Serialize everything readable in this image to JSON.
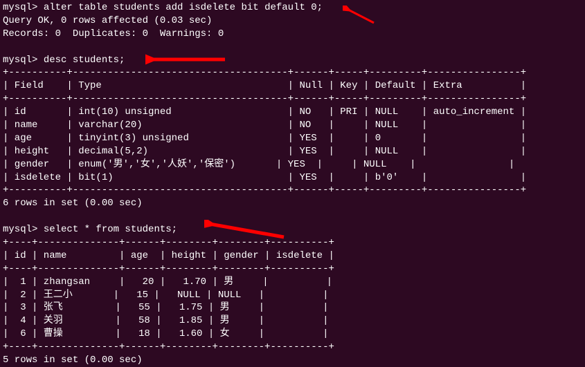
{
  "session": {
    "prompt1": "mysql> ",
    "cmd1": "alter table students add isdelete bit default 0;",
    "result1a": "Query OK, 0 rows affected (0.03 sec)",
    "result1b": "Records: 0  Duplicates: 0  Warnings: 0",
    "prompt2": "mysql> ",
    "cmd2": "desc students;",
    "desc_border": "+----------+-------------------------------------+------+-----+---------+----------------+",
    "desc_header": "| Field    | Type                                | Null | Key | Default | Extra          |",
    "desc_rows": [
      "| id       | int(10) unsigned                    | NO   | PRI | NULL    | auto_increment |",
      "| name     | varchar(20)                         | NO   |     | NULL    |                |",
      "| age      | tinyint(3) unsigned                 | YES  |     | 0       |                |",
      "| height   | decimal(5,2)                        | YES  |     | NULL    |                |",
      "| gender   | enum('男','女','人妖','保密')       | YES  |     | NULL    |                |",
      "| isdelete | bit(1)                              | YES  |     | b'0'    |                |"
    ],
    "desc_summary": "6 rows in set (0.00 sec)",
    "prompt3": "mysql> ",
    "cmd3": "select * from students;",
    "sel_border": "+----+--------------+------+--------+--------+----------+",
    "sel_header": "| id | name         | age  | height | gender | isdelete |",
    "sel_rows": [
      "|  1 | zhangsan     |   20 |   1.70 | 男     |          |",
      "|  2 | 王二小       |   15 |   NULL | NULL   |          |",
      "|  3 | 张飞         |   55 |   1.75 | 男     |          |",
      "|  4 | 关羽         |   58 |   1.85 | 男     |          |",
      "|  6 | 曹操         |   18 |   1.60 | 女     |          |"
    ],
    "sel_summary": "5 rows in set (0.00 sec)"
  },
  "chart_data": {
    "type": "table",
    "tables": [
      {
        "name": "desc students",
        "columns": [
          "Field",
          "Type",
          "Null",
          "Key",
          "Default",
          "Extra"
        ],
        "rows": [
          [
            "id",
            "int(10) unsigned",
            "NO",
            "PRI",
            "NULL",
            "auto_increment"
          ],
          [
            "name",
            "varchar(20)",
            "NO",
            "",
            "NULL",
            ""
          ],
          [
            "age",
            "tinyint(3) unsigned",
            "YES",
            "",
            "0",
            ""
          ],
          [
            "height",
            "decimal(5,2)",
            "YES",
            "",
            "NULL",
            ""
          ],
          [
            "gender",
            "enum('男','女','人妖','保密')",
            "YES",
            "",
            "NULL",
            ""
          ],
          [
            "isdelete",
            "bit(1)",
            "YES",
            "",
            "b'0'",
            ""
          ]
        ]
      },
      {
        "name": "select * from students",
        "columns": [
          "id",
          "name",
          "age",
          "height",
          "gender",
          "isdelete"
        ],
        "rows": [
          [
            1,
            "zhangsan",
            20,
            1.7,
            "男",
            ""
          ],
          [
            2,
            "王二小",
            15,
            null,
            null,
            ""
          ],
          [
            3,
            "张飞",
            55,
            1.75,
            "男",
            ""
          ],
          [
            4,
            "关羽",
            58,
            1.85,
            "男",
            ""
          ],
          [
            6,
            "曹操",
            18,
            1.6,
            "女",
            ""
          ]
        ]
      }
    ]
  }
}
